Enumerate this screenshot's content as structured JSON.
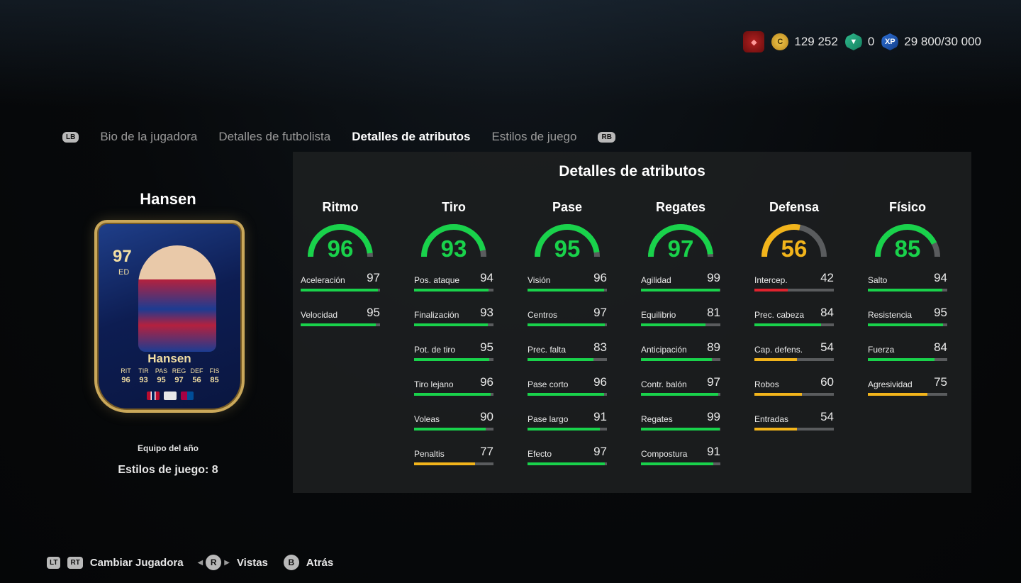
{
  "currency": {
    "coins": "129 252",
    "points": "0",
    "xp": "29 800/30 000",
    "coin_icon_text": "C",
    "xp_icon_text": "XP"
  },
  "tabs": {
    "left_button": "LB",
    "right_button": "RB",
    "items": [
      "Bio de la jugadora",
      "Detalles de futbolista",
      "Detalles de atributos",
      "Estilos de juego"
    ],
    "active": "Detalles de atributos"
  },
  "player": {
    "name": "Hansen",
    "card_rating": "97",
    "card_position": "ED",
    "card_name": "Hansen",
    "card_stat_labels": [
      "RIT",
      "TIR",
      "PAS",
      "REG",
      "DEF",
      "FIS"
    ],
    "card_stat_values": [
      "96",
      "93",
      "95",
      "97",
      "56",
      "85"
    ],
    "subtitle": "Equipo del año",
    "playstyles": "Estilos de juego: 8"
  },
  "panel": {
    "title": "Detalles de atributos",
    "categories": [
      {
        "name": "Ritmo",
        "value": 96,
        "color": "#19d24b",
        "attrs": [
          {
            "name": "Aceleración",
            "value": 97
          },
          {
            "name": "Velocidad",
            "value": 95
          }
        ]
      },
      {
        "name": "Tiro",
        "value": 93,
        "color": "#19d24b",
        "attrs": [
          {
            "name": "Pos. ataque",
            "value": 94
          },
          {
            "name": "Finalización",
            "value": 93
          },
          {
            "name": "Pot. de tiro",
            "value": 95
          },
          {
            "name": "Tiro lejano",
            "value": 96
          },
          {
            "name": "Voleas",
            "value": 90
          },
          {
            "name": "Penaltis",
            "value": 77
          }
        ]
      },
      {
        "name": "Pase",
        "value": 95,
        "color": "#19d24b",
        "attrs": [
          {
            "name": "Visión",
            "value": 96
          },
          {
            "name": "Centros",
            "value": 97
          },
          {
            "name": "Prec. falta",
            "value": 83
          },
          {
            "name": "Pase corto",
            "value": 96
          },
          {
            "name": "Pase largo",
            "value": 91
          },
          {
            "name": "Efecto",
            "value": 97
          }
        ]
      },
      {
        "name": "Regates",
        "value": 97,
        "color": "#19d24b",
        "attrs": [
          {
            "name": "Agilidad",
            "value": 99
          },
          {
            "name": "Equilibrio",
            "value": 81
          },
          {
            "name": "Anticipación",
            "value": 89
          },
          {
            "name": "Contr. balón",
            "value": 97
          },
          {
            "name": "Regates",
            "value": 99
          },
          {
            "name": "Compostura",
            "value": 91
          }
        ]
      },
      {
        "name": "Defensa",
        "value": 56,
        "color": "#f2b41b",
        "attrs": [
          {
            "name": "Intercep.",
            "value": 42
          },
          {
            "name": "Prec. cabeza",
            "value": 84
          },
          {
            "name": "Cap. defens.",
            "value": 54
          },
          {
            "name": "Robos",
            "value": 60
          },
          {
            "name": "Entradas",
            "value": 54
          }
        ]
      },
      {
        "name": "Físico",
        "value": 85,
        "color": "#19d24b",
        "attrs": [
          {
            "name": "Salto",
            "value": 94
          },
          {
            "name": "Resistencia",
            "value": 95
          },
          {
            "name": "Fuerza",
            "value": 84
          },
          {
            "name": "Agresividad",
            "value": 75
          }
        ]
      }
    ]
  },
  "colors": {
    "high": "#19d24b",
    "mid": "#f2b41b",
    "low": "#e0232e",
    "track": "#5a5c5e"
  },
  "controls": {
    "lt": "LT",
    "rt": "RT",
    "change_player": "Cambiar Jugadora",
    "r_button": "R",
    "views": "Vistas",
    "b_button": "B",
    "back": "Atrás"
  }
}
